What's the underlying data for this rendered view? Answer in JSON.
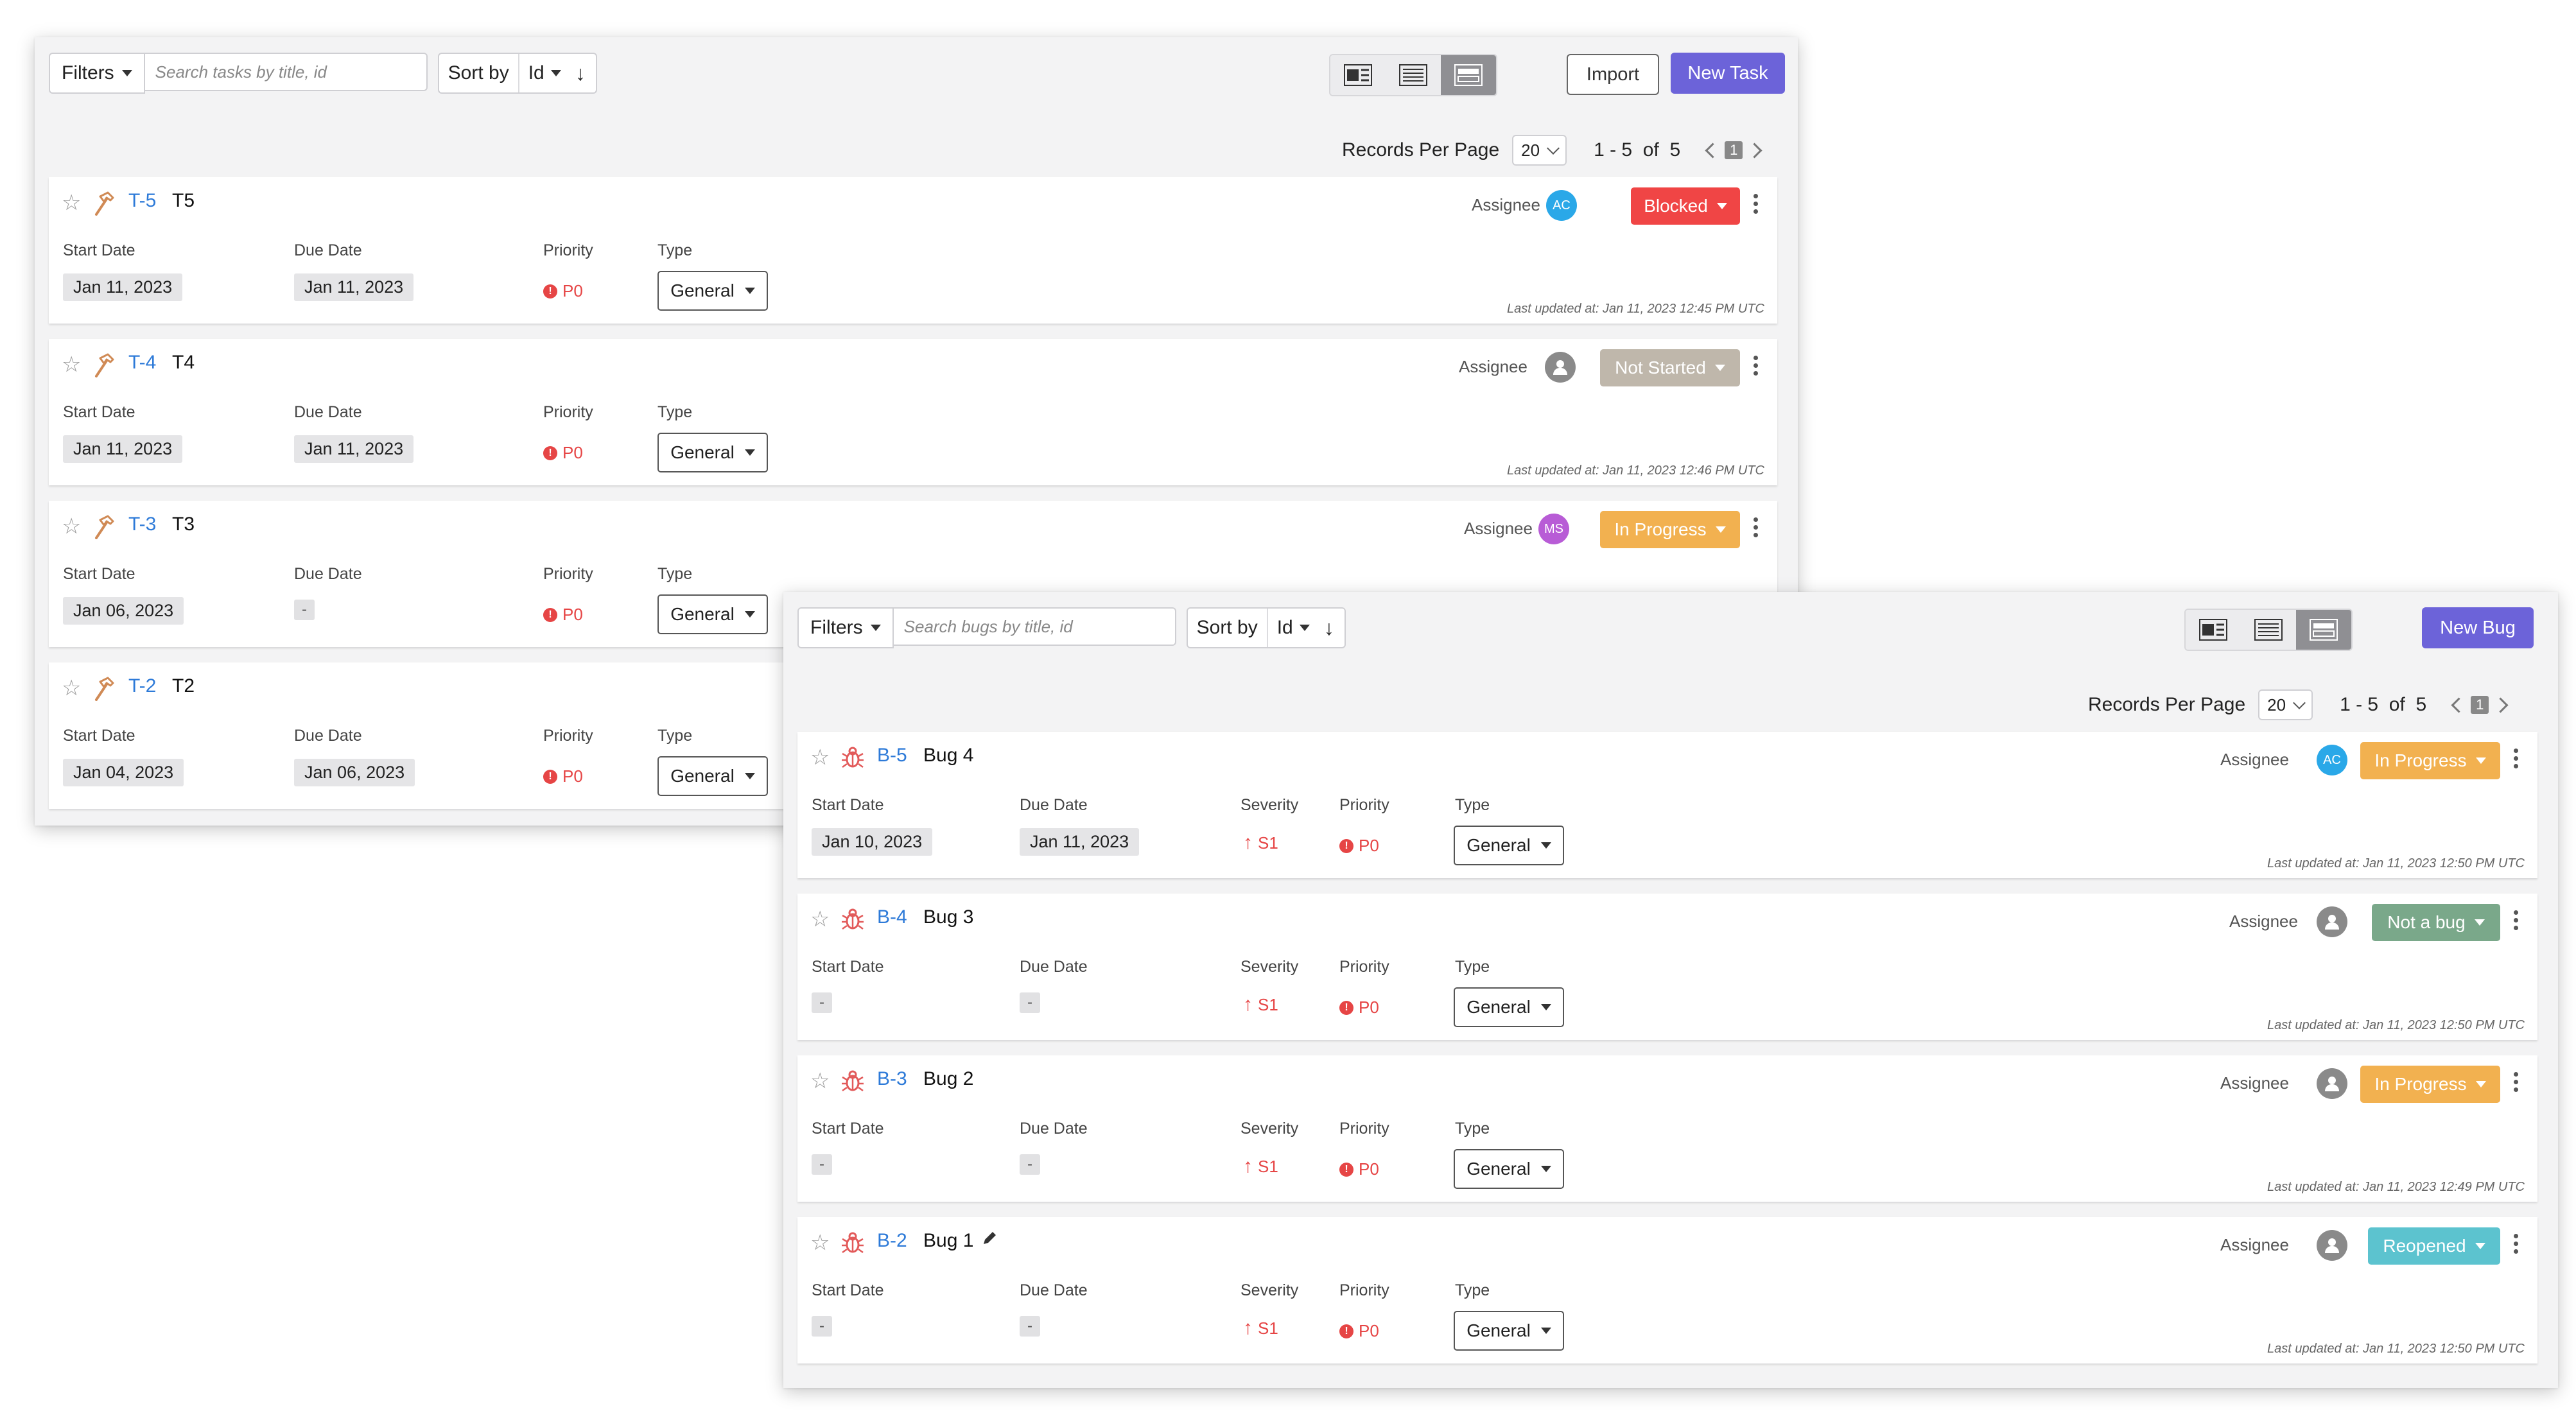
{
  "tasks_panel": {
    "filters_label": "Filters",
    "search_placeholder": "Search tasks by title, id",
    "sort_label": "Sort by",
    "sort_value": "Id",
    "sort_direction": "↓",
    "views": [
      "card-view-icon",
      "list-view-icon",
      "compact-view-icon"
    ],
    "active_view": "compact-view-icon",
    "import_label": "Import",
    "new_label": "New Task",
    "records_label": "Records Per Page",
    "records_value": "20",
    "range_text": "1 - 5  of  5",
    "page": "1",
    "labels": {
      "start": "Start Date",
      "due": "Due Date",
      "priority": "Priority",
      "type": "Type",
      "assignee": "Assignee"
    },
    "items": [
      {
        "id": "T-5",
        "title": "T5",
        "start": "Jan 11, 2023",
        "due": "Jan 11, 2023",
        "priority": "P0",
        "type": "General",
        "assignee": "AC",
        "assignee_color": "#2aa8e8",
        "status": "Blocked",
        "status_color": "#f04545",
        "updated": "Last updated at: Jan 11, 2023 12:45 PM UTC"
      },
      {
        "id": "T-4",
        "title": "T4",
        "start": "Jan 11, 2023",
        "due": "Jan 11, 2023",
        "priority": "P0",
        "type": "General",
        "assignee": "",
        "assignee_color": "#8a8a8a",
        "status": "Not Started",
        "status_color": "#bfb7ab",
        "updated": "Last updated at: Jan 11, 2023 12:46 PM UTC"
      },
      {
        "id": "T-3",
        "title": "T3",
        "start": "Jan 06, 2023",
        "due": "-",
        "priority": "P0",
        "type": "General",
        "assignee": "MS",
        "assignee_color": "#b85cd6",
        "status": "In Progress",
        "status_color": "#f2b150",
        "updated": ""
      },
      {
        "id": "T-2",
        "title": "T2",
        "start": "Jan 04, 2023",
        "due": "Jan 06, 2023",
        "priority": "P0",
        "type": "General",
        "assignee": "",
        "assignee_color": "",
        "status": "",
        "status_color": "",
        "updated": ""
      }
    ]
  },
  "bugs_panel": {
    "filters_label": "Filters",
    "search_placeholder": "Search bugs by title, id",
    "sort_label": "Sort by",
    "sort_value": "Id",
    "sort_direction": "↓",
    "views": [
      "card-view-icon",
      "list-view-icon",
      "compact-view-icon"
    ],
    "active_view": "compact-view-icon",
    "new_label": "New Bug",
    "records_label": "Records Per Page",
    "records_value": "20",
    "range_text": "1 - 5  of  5",
    "page": "1",
    "labels": {
      "start": "Start Date",
      "due": "Due Date",
      "severity": "Severity",
      "priority": "Priority",
      "type": "Type",
      "assignee": "Assignee"
    },
    "items": [
      {
        "id": "B-5",
        "title": "Bug 4",
        "start": "Jan 10, 2023",
        "due": "Jan 11, 2023",
        "severity": "S1",
        "priority": "P0",
        "type": "General",
        "assignee": "AC",
        "assignee_color": "#2aa8e8",
        "status": "In Progress",
        "status_color": "#f2b150",
        "updated": "Last updated at: Jan 11, 2023 12:50 PM UTC"
      },
      {
        "id": "B-4",
        "title": "Bug 3",
        "start": "-",
        "due": "-",
        "severity": "S1",
        "priority": "P0",
        "type": "General",
        "assignee": "",
        "assignee_color": "#8a8a8a",
        "status": "Not a bug",
        "status_color": "#7aa88a",
        "updated": "Last updated at: Jan 11, 2023 12:50 PM UTC"
      },
      {
        "id": "B-3",
        "title": "Bug 2",
        "start": "-",
        "due": "-",
        "severity": "S1",
        "priority": "P0",
        "type": "General",
        "assignee": "",
        "assignee_color": "#8a8a8a",
        "status": "In Progress",
        "status_color": "#f2b150",
        "updated": "Last updated at: Jan 11, 2023 12:49 PM UTC"
      },
      {
        "id": "B-2",
        "title": "Bug 1",
        "start": "-",
        "due": "-",
        "severity": "S1",
        "priority": "P0",
        "type": "General",
        "assignee": "",
        "assignee_color": "#8a8a8a",
        "status": "Reopened",
        "status_color": "#5cc3cf",
        "updated": "Last updated at: Jan 11, 2023 12:50 PM UTC"
      }
    ]
  }
}
